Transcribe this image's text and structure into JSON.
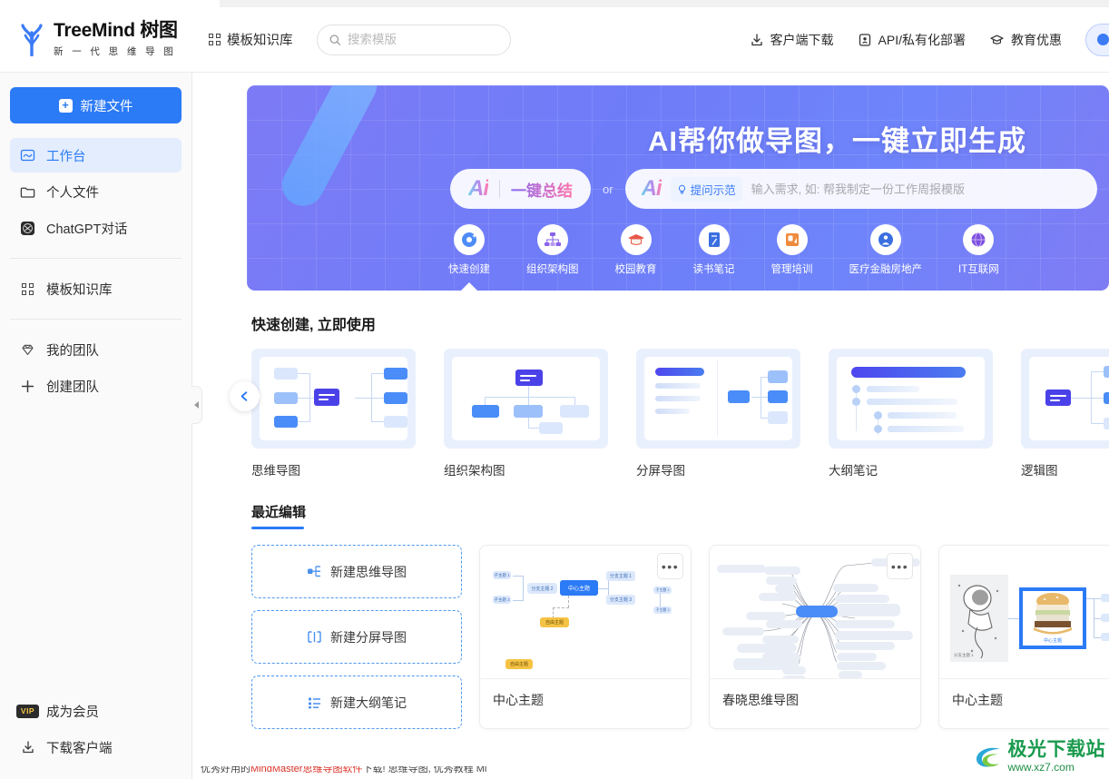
{
  "header": {
    "logo_title": "TreeMind 树图",
    "logo_sub": "新 一 代 思 维 导 图",
    "nav_knowledge": "模板知识库",
    "search_placeholder": "搜索模版",
    "search_value": "",
    "right_items": [
      {
        "label": "客户端下载",
        "icon": "download-icon"
      },
      {
        "label": "API/私有化部署",
        "icon": "api-icon"
      },
      {
        "label": "教育优惠",
        "icon": "graduation-cap-icon"
      }
    ]
  },
  "sidebar": {
    "new_file_label": "新建文件",
    "items": [
      {
        "label": "工作台",
        "icon": "workbench-icon",
        "active": true
      },
      {
        "label": "个人文件",
        "icon": "folder-icon",
        "active": false
      },
      {
        "label": "ChatGPT对话",
        "icon": "chatgpt-icon",
        "active": false
      }
    ],
    "items2": [
      {
        "label": "模板知识库",
        "icon": "grid-icon"
      }
    ],
    "items3": [
      {
        "label": "我的团队",
        "icon": "diamond-icon"
      },
      {
        "label": "创建团队",
        "icon": "plus-icon"
      }
    ],
    "bottom": [
      {
        "label": "成为会员",
        "badge": "VIP"
      },
      {
        "label": "下载客户端",
        "icon": "download-icon"
      }
    ]
  },
  "banner": {
    "title": "AI帮你做导图，一键立即生成",
    "ai_logo": "Ai",
    "summary_label": "一键总结",
    "or_label": "or",
    "demo_label": "提问示范",
    "input_placeholder": "输入需求, 如: 帮我制定一份工作周报模版",
    "input_value": "",
    "categories": [
      {
        "label": "快速创建",
        "icon": "sparkle-icon",
        "active": true
      },
      {
        "label": "组织架构图",
        "icon": "org-chart-icon",
        "active": false
      },
      {
        "label": "校园教育",
        "icon": "graduation-cap-icon",
        "active": false
      },
      {
        "label": "读书笔记",
        "icon": "notebook-icon",
        "active": false
      },
      {
        "label": "管理培训",
        "icon": "training-icon",
        "active": false
      },
      {
        "label": "医疗金融房地产",
        "icon": "briefcase-icon",
        "active": false
      },
      {
        "label": "IT互联网",
        "icon": "globe-icon",
        "active": false
      }
    ]
  },
  "quick_create": {
    "section_title": "快速创建, 立即使用",
    "prev_label": "‹",
    "templates": [
      {
        "label": "思维导图",
        "kind": "mindmap"
      },
      {
        "label": "组织架构图",
        "kind": "org"
      },
      {
        "label": "分屏导图",
        "kind": "split"
      },
      {
        "label": "大纲笔记",
        "kind": "outline"
      },
      {
        "label": "逻辑图",
        "kind": "logic"
      }
    ]
  },
  "recent": {
    "section_title": "最近编辑",
    "new_buttons": [
      {
        "label": "新建思维导图",
        "icon": "mindmap-icon"
      },
      {
        "label": "新建分屏导图",
        "icon": "split-icon"
      },
      {
        "label": "新建大纲笔记",
        "icon": "list-icon"
      }
    ],
    "more_glyph": "•••",
    "files": [
      {
        "name": "中心主题",
        "kind": "mindmap-classic"
      },
      {
        "name": "春晓思维导图",
        "kind": "mindmap-fan"
      },
      {
        "name": "中心主题",
        "kind": "mindmap-image"
      }
    ],
    "map_nodes": {
      "center": "中心主题",
      "branch1": "分支主题 1",
      "branch2": "分支主题 2",
      "branch3": "分支主题 3",
      "sub1": "子主题 1",
      "sub2": "子主题 2",
      "free": "自由主题"
    }
  },
  "bottom_strip": {
    "text_part1": "优秀好用的",
    "text_red": "MindMaster思维导图软件",
    "text_part2": "下载! 思维导图, 优秀教程 Mi"
  },
  "watermark": {
    "text": "极光下载站",
    "url": "www.xz7.com"
  },
  "colors": {
    "accent": "#2b7af6",
    "banner_from": "#7d7bf5",
    "banner_to": "#7f7cf4",
    "vip_gold": "#f5c544",
    "watermark_green": "#1a9b4e"
  }
}
